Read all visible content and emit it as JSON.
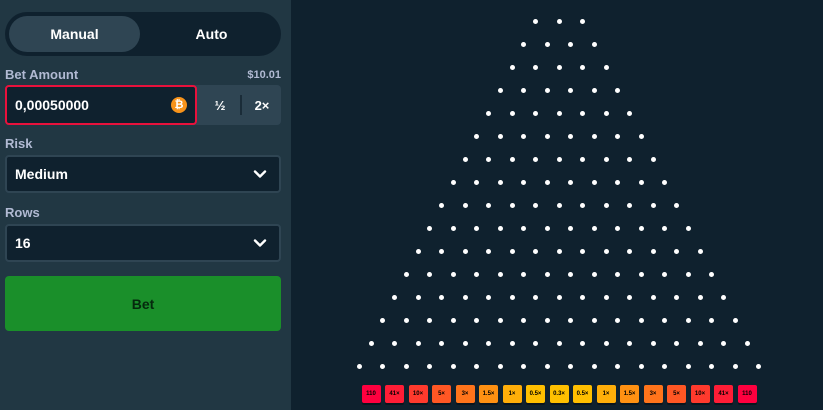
{
  "mode_toggle": {
    "manual_label": "Manual",
    "auto_label": "Auto"
  },
  "bet": {
    "label": "Bet Amount",
    "usd_value": "$10.01",
    "amount": "0,00050000",
    "coin_symbol": "₿",
    "half_label": "½",
    "double_label": "2×"
  },
  "risk": {
    "label": "Risk",
    "selected": "Medium"
  },
  "rows": {
    "label": "Rows",
    "selected": "16"
  },
  "bet_button": {
    "label": "Bet"
  },
  "board": {
    "row_count": 16,
    "buckets": [
      {
        "label": "110",
        "color": "#ff003f"
      },
      {
        "label": "41×",
        "color": "#ff1d36"
      },
      {
        "label": "10×",
        "color": "#ff3a2d"
      },
      {
        "label": "5×",
        "color": "#ff5724"
      },
      {
        "label": "3×",
        "color": "#ff741b"
      },
      {
        "label": "1.5×",
        "color": "#ff9112"
      },
      {
        "label": "1×",
        "color": "#ffae09"
      },
      {
        "label": "0.5×",
        "color": "#ffbf00"
      },
      {
        "label": "0.3×",
        "color": "#ffc000"
      },
      {
        "label": "0.5×",
        "color": "#ffbf00"
      },
      {
        "label": "1×",
        "color": "#ffae09"
      },
      {
        "label": "1.5×",
        "color": "#ff9112"
      },
      {
        "label": "3×",
        "color": "#ff741b"
      },
      {
        "label": "5×",
        "color": "#ff5724"
      },
      {
        "label": "10×",
        "color": "#ff3a2d"
      },
      {
        "label": "41×",
        "color": "#ff1d36"
      },
      {
        "label": "110",
        "color": "#ff003f"
      }
    ]
  }
}
